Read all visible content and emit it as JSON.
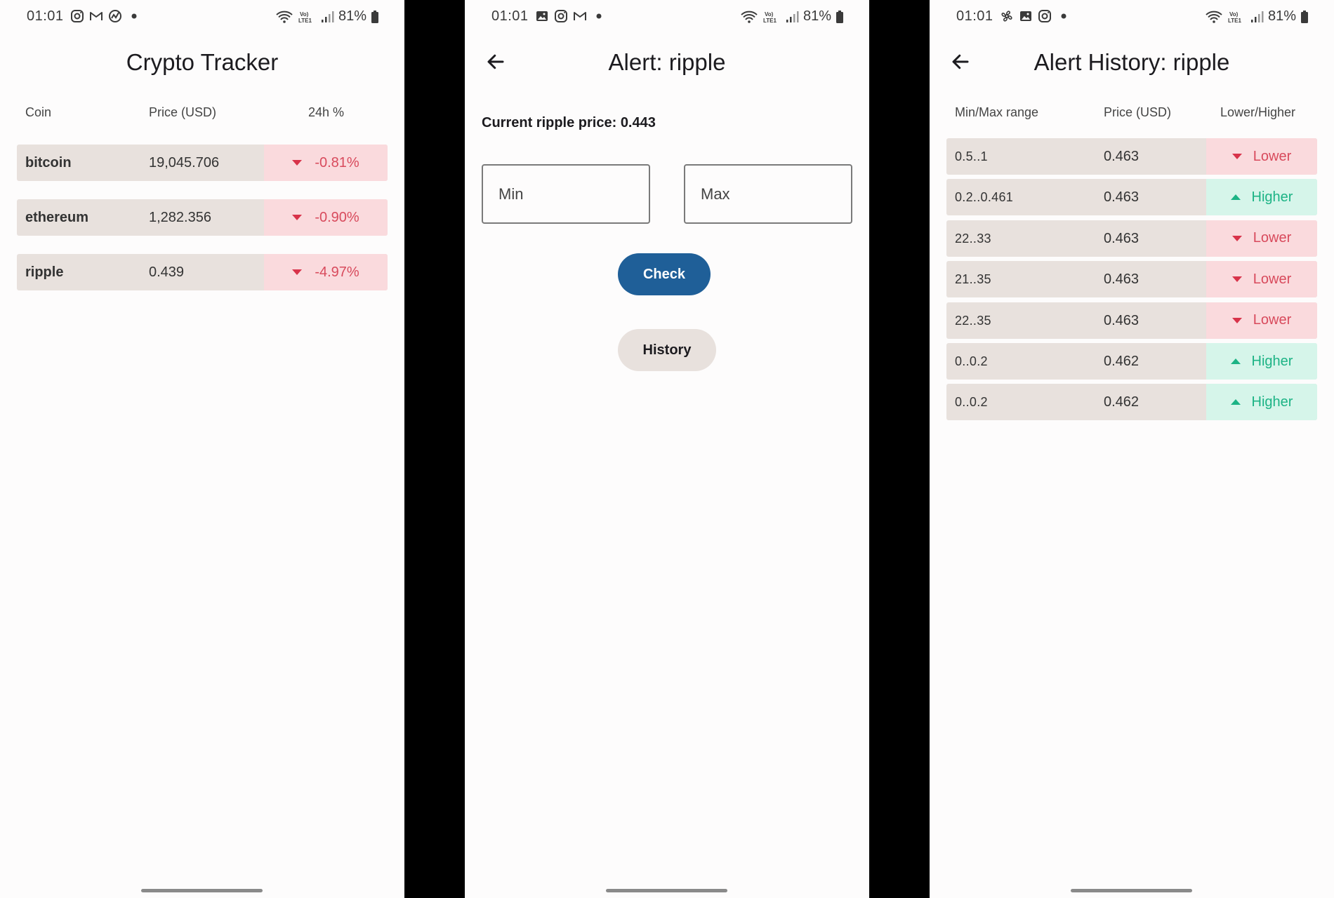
{
  "status_bar": {
    "time": "01:01",
    "battery": "81%"
  },
  "coin_list": {
    "title": "Crypto Tracker",
    "headers": {
      "coin": "Coin",
      "price": "Price (USD)",
      "change": "24h %"
    },
    "rows": [
      {
        "coin": "bitcoin",
        "price": "19,045.706",
        "change": "-0.81%"
      },
      {
        "coin": "ethereum",
        "price": "1,282.356",
        "change": "-0.90%"
      },
      {
        "coin": "ripple",
        "price": "0.439",
        "change": "-4.97%"
      }
    ]
  },
  "alert": {
    "title": "Alert: ripple",
    "current_price": "Current ripple price: 0.443",
    "min_placeholder": "Min",
    "max_placeholder": "Max",
    "check_label": "Check",
    "history_label": "History"
  },
  "history": {
    "title": "Alert History: ripple",
    "headers": {
      "range": "Min/Max range",
      "price": "Price (USD)",
      "direction": "Lower/Higher"
    },
    "rows": [
      {
        "range": "0.5..1",
        "price": "0.463",
        "direction": "Lower"
      },
      {
        "range": "0.2..0.461",
        "price": "0.463",
        "direction": "Higher"
      },
      {
        "range": "22..33",
        "price": "0.463",
        "direction": "Lower"
      },
      {
        "range": "21..35",
        "price": "0.463",
        "direction": "Lower"
      },
      {
        "range": "22..35",
        "price": "0.463",
        "direction": "Lower"
      },
      {
        "range": "0..0.2",
        "price": "0.462",
        "direction": "Higher"
      },
      {
        "range": "0..0.2",
        "price": "0.462",
        "direction": "Higher"
      }
    ]
  },
  "colors": {
    "accent_blue": "#1f5f98",
    "row_bg": "#e8e1dd",
    "negative": "#d84a5c",
    "negative_bg": "#fadadd",
    "positive": "#1cb385",
    "positive_bg": "#d6f5ea"
  }
}
